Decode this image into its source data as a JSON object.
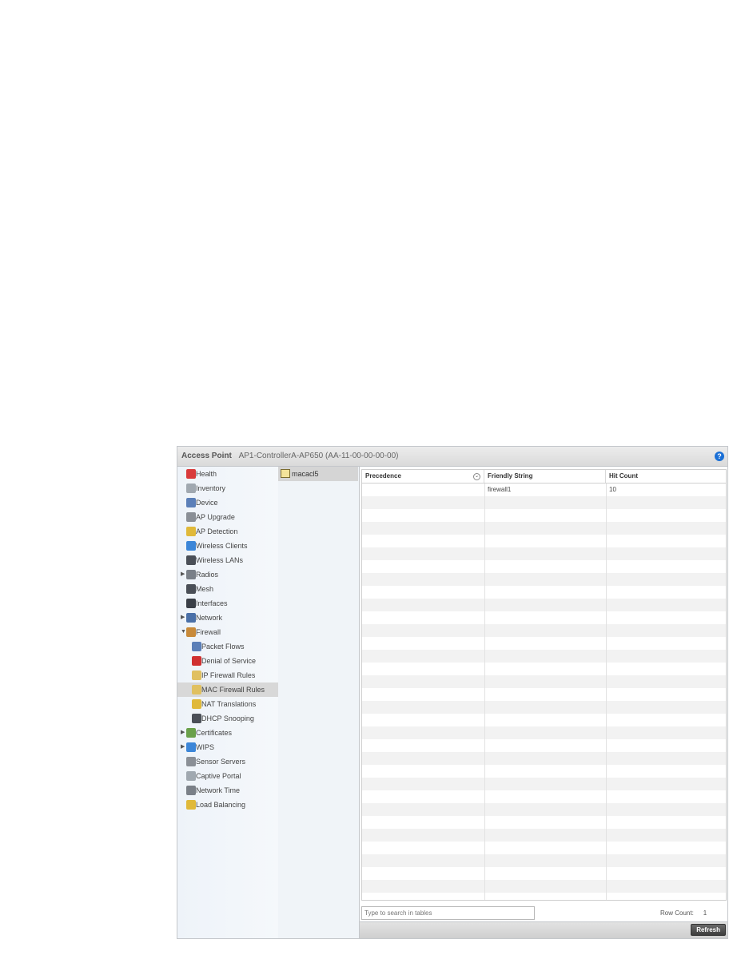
{
  "header": {
    "title": "Access Point",
    "subtitle": "AP1-ControllerA-AP650 (AA-11-00-00-00-00)",
    "help": "?"
  },
  "sidebar": {
    "items": [
      {
        "label": "Health",
        "icon": "health-icon",
        "color": "#d93b3b",
        "arrow": "",
        "indent": 0
      },
      {
        "label": "Inventory",
        "icon": "inventory-icon",
        "color": "#a0a8b0",
        "arrow": "",
        "indent": 0
      },
      {
        "label": "Device",
        "icon": "device-icon",
        "color": "#5b7fb8",
        "arrow": "",
        "indent": 0
      },
      {
        "label": "AP Upgrade",
        "icon": "ap-upgrade-icon",
        "color": "#8a8f96",
        "arrow": "",
        "indent": 0
      },
      {
        "label": "AP Detection",
        "icon": "ap-detection-icon",
        "color": "#e0b93a",
        "arrow": "",
        "indent": 0
      },
      {
        "label": "Wireless Clients",
        "icon": "wireless-clients-icon",
        "color": "#3c86d8",
        "arrow": "",
        "indent": 0
      },
      {
        "label": "Wireless LANs",
        "icon": "wireless-lans-icon",
        "color": "#4a4f57",
        "arrow": "",
        "indent": 0
      },
      {
        "label": "Radios",
        "icon": "radios-icon",
        "color": "#7a8088",
        "arrow": "▶",
        "indent": 0
      },
      {
        "label": "Mesh",
        "icon": "mesh-icon",
        "color": "#4a4f57",
        "arrow": "",
        "indent": 0
      },
      {
        "label": "Interfaces",
        "icon": "interfaces-icon",
        "color": "#3a3f47",
        "arrow": "",
        "indent": 0
      },
      {
        "label": "Network",
        "icon": "network-icon",
        "color": "#4a70a8",
        "arrow": "▶",
        "indent": 0
      },
      {
        "label": "Firewall",
        "icon": "firewall-icon",
        "color": "#c88a3a",
        "arrow": "▼",
        "indent": 0
      },
      {
        "label": "Packet Flows",
        "icon": "packet-flows-icon",
        "color": "#5b7fb8",
        "arrow": "",
        "indent": 1
      },
      {
        "label": "Denial of Service",
        "icon": "denial-of-service-icon",
        "color": "#d03030",
        "arrow": "",
        "indent": 1
      },
      {
        "label": "IP Firewall Rules",
        "icon": "ip-firewall-rules-icon",
        "color": "#e0c060",
        "arrow": "",
        "indent": 1
      },
      {
        "label": "MAC Firewall Rules",
        "icon": "mac-firewall-rules-icon",
        "color": "#e0c060",
        "arrow": "",
        "indent": 1,
        "selected": true
      },
      {
        "label": "NAT Translations",
        "icon": "nat-translations-icon",
        "color": "#e0b93a",
        "arrow": "",
        "indent": 1
      },
      {
        "label": "DHCP Snooping",
        "icon": "dhcp-snooping-icon",
        "color": "#4a4f57",
        "arrow": "",
        "indent": 1
      },
      {
        "label": "Certificates",
        "icon": "certificates-icon",
        "color": "#6aa04a",
        "arrow": "▶",
        "indent": 0
      },
      {
        "label": "WIPS",
        "icon": "wips-icon",
        "color": "#3c86d8",
        "arrow": "▶",
        "indent": 0
      },
      {
        "label": "Sensor Servers",
        "icon": "sensor-servers-icon",
        "color": "#8a8f96",
        "arrow": "",
        "indent": 0
      },
      {
        "label": "Captive Portal",
        "icon": "captive-portal-icon",
        "color": "#a0a8b0",
        "arrow": "",
        "indent": 0
      },
      {
        "label": "Network Time",
        "icon": "network-time-icon",
        "color": "#7a8088",
        "arrow": "",
        "indent": 0
      },
      {
        "label": "Load Balancing",
        "icon": "load-balancing-icon",
        "color": "#e0b93a",
        "arrow": "",
        "indent": 0
      }
    ]
  },
  "list": {
    "items": [
      {
        "label": "macacl5",
        "icon": "acl-icon"
      }
    ]
  },
  "table": {
    "columns": [
      "Precedence",
      "Friendly String",
      "Hit Count"
    ],
    "rows": [
      {
        "precedence": "",
        "friendly_string": "firewall1",
        "hit_count": "10"
      }
    ],
    "empty_rows": 32
  },
  "search": {
    "placeholder": "Type to search in tables"
  },
  "row_count": {
    "label": "Row Count:",
    "value": "1"
  },
  "footer": {
    "refresh_label": "Refresh"
  }
}
